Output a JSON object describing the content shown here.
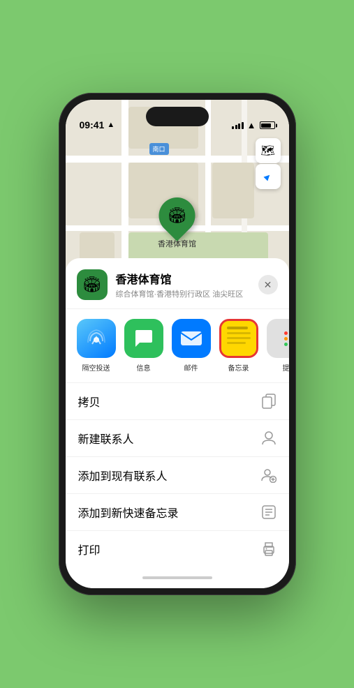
{
  "status_bar": {
    "time": "09:41",
    "location_arrow": "▲"
  },
  "map": {
    "south_label": "南口",
    "pin_label": "香港体育馆",
    "pin_emoji": "🏟"
  },
  "map_controls": {
    "layers_icon": "🗺",
    "location_icon": "➤"
  },
  "venue": {
    "name": "香港体育馆",
    "description": "综合体育馆·香港特别行政区 油尖旺区",
    "icon": "🏟"
  },
  "share_items": [
    {
      "id": "airdrop",
      "label": "隔空投送",
      "emoji": "📡",
      "bg_class": "airdrop"
    },
    {
      "id": "messages",
      "label": "信息",
      "emoji": "💬",
      "bg_class": "messages"
    },
    {
      "id": "mail",
      "label": "邮件",
      "emoji": "✉️",
      "bg_class": "mail"
    },
    {
      "id": "notes",
      "label": "备忘录",
      "emoji": "notes",
      "bg_class": "notes"
    }
  ],
  "more_label": "提",
  "actions": [
    {
      "id": "copy",
      "label": "拷贝",
      "icon": "⎘"
    },
    {
      "id": "new-contact",
      "label": "新建联系人",
      "icon": "👤"
    },
    {
      "id": "add-contact",
      "label": "添加到现有联系人",
      "icon": "👤"
    },
    {
      "id": "quick-note",
      "label": "添加到新快速备忘录",
      "icon": "📋"
    },
    {
      "id": "print",
      "label": "打印",
      "icon": "🖨"
    }
  ],
  "close_btn": "✕"
}
